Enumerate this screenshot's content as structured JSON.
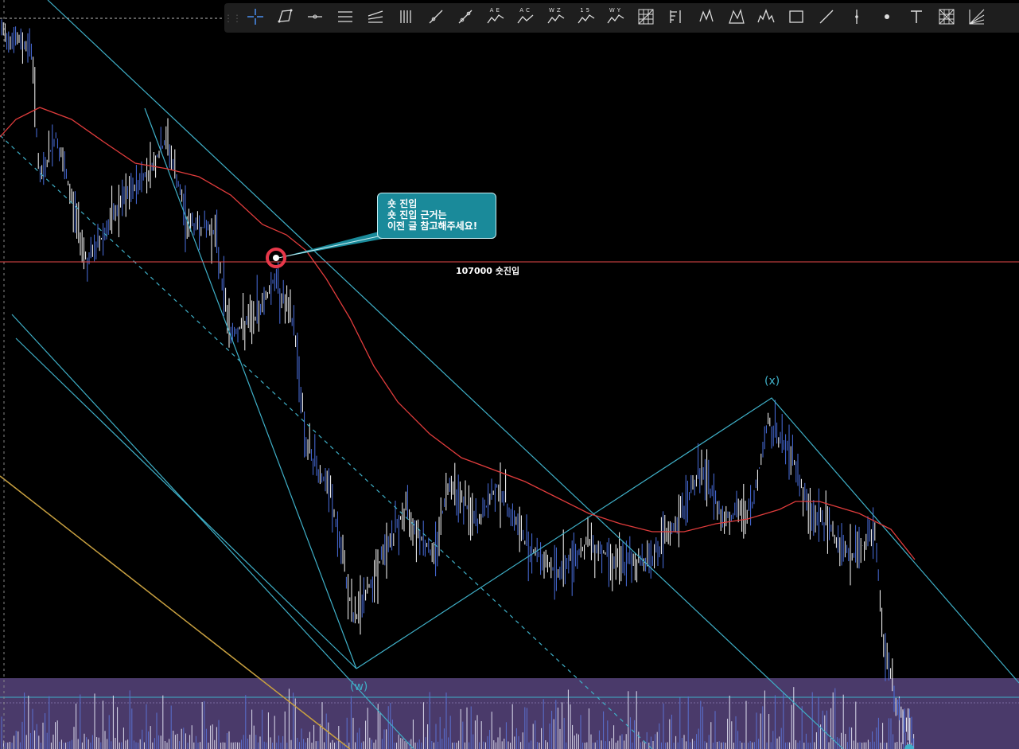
{
  "toolbar": {
    "tools": [
      {
        "icon": "crosshair-icon",
        "sub": ""
      },
      {
        "icon": "polygon-icon",
        "sub": ""
      },
      {
        "icon": "horizontal-ray-icon",
        "sub": ""
      },
      {
        "icon": "parallel-lines-icon",
        "sub": ""
      },
      {
        "icon": "fan-lines-icon",
        "sub": ""
      },
      {
        "icon": "vertical-lines-icon",
        "sub": ""
      },
      {
        "icon": "trend-line-icon",
        "sub": ""
      },
      {
        "icon": "segment-icon",
        "sub": ""
      },
      {
        "icon": "wave-ae-icon",
        "sub": "AE"
      },
      {
        "icon": "wave-ac-icon",
        "sub": "AC"
      },
      {
        "icon": "wave-wz-icon",
        "sub": "WZ"
      },
      {
        "icon": "wave-15-icon",
        "sub": "15"
      },
      {
        "icon": "wave-wy-icon",
        "sub": "WY"
      },
      {
        "icon": "grid-icon",
        "sub": ""
      },
      {
        "icon": "fib-icon",
        "sub": ""
      },
      {
        "icon": "pattern-icon",
        "sub": ""
      },
      {
        "icon": "xabcd-icon",
        "sub": ""
      },
      {
        "icon": "head-shoulders-icon",
        "sub": ""
      },
      {
        "icon": "rectangle-icon",
        "sub": ""
      },
      {
        "icon": "line-icon",
        "sub": ""
      },
      {
        "icon": "vertical-line-icon",
        "sub": ""
      },
      {
        "icon": "dot-icon",
        "sub": ""
      },
      {
        "icon": "text-icon",
        "sub": ""
      },
      {
        "icon": "gann-box-icon",
        "sub": ""
      },
      {
        "icon": "gann-fan-icon",
        "sub": ""
      }
    ]
  },
  "callout": {
    "line1": "숏 진입",
    "line2": "숏 진입 근거는",
    "line3": "이전 글 참고해주세요!",
    "bg": "#1a8a9a"
  },
  "price_line": {
    "label": "107000 숏진입",
    "color": "#e84a4a"
  },
  "wave_labels": {
    "x": "(x)",
    "w": "(w)"
  },
  "colors": {
    "candles": "#4a6fe0",
    "channel": "#3fb0c8",
    "moving_average": "#e03c3c",
    "volume_band": "#4a3a6a",
    "marker_ring": "#e8384a"
  }
}
